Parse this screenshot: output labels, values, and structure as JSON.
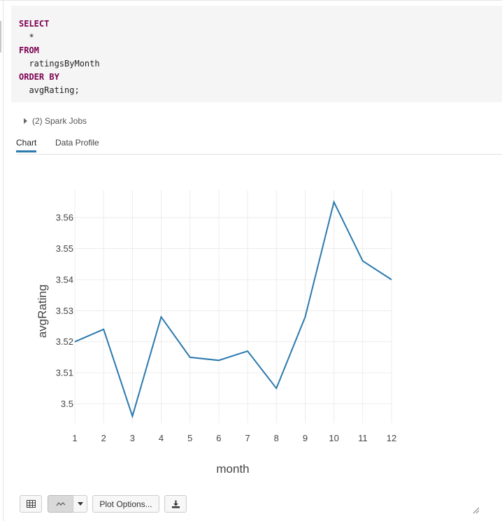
{
  "code": {
    "lines": [
      {
        "text": "SELECT",
        "keyword": true
      },
      {
        "text": "  *",
        "keyword": false
      },
      {
        "text": "FROM",
        "keyword": true
      },
      {
        "text": "  ratingsByMonth",
        "keyword": false
      },
      {
        "text": "ORDER BY",
        "keyword": true
      },
      {
        "text": "  avgRating;",
        "keyword": false
      }
    ]
  },
  "spark_jobs": {
    "label": "(2) Spark Jobs"
  },
  "tabs": [
    {
      "label": "Chart",
      "active": true
    },
    {
      "label": "Data Profile",
      "active": false
    }
  ],
  "chart_data": {
    "type": "line",
    "xlabel": "month",
    "ylabel": "avgRating",
    "x": [
      1,
      2,
      3,
      4,
      5,
      6,
      7,
      8,
      9,
      10,
      11,
      12
    ],
    "series": [
      {
        "values": [
          3.52,
          3.524,
          3.496,
          3.528,
          3.515,
          3.514,
          3.517,
          3.505,
          3.528,
          3.565,
          3.546,
          3.54
        ]
      }
    ],
    "xticks": [
      "1",
      "2",
      "3",
      "4",
      "5",
      "6",
      "7",
      "8",
      "9",
      "10",
      "11",
      "12"
    ],
    "yticks": [
      3.5,
      3.51,
      3.52,
      3.53,
      3.54,
      3.55,
      3.56
    ],
    "ytick_labels": [
      "3.5",
      "3.51",
      "3.52",
      "3.53",
      "3.54",
      "3.55",
      "3.56"
    ],
    "xlim": [
      1,
      12
    ],
    "ylim": [
      3.4938,
      3.5688
    ],
    "grid": true,
    "line_color": "#2b79ae"
  },
  "toolbar": {
    "table_icon": "table-icon",
    "line_chart_icon": "line-chart-icon",
    "dropdown_icon": "chevron-down-icon",
    "plot_options_label": "Plot Options...",
    "download_icon": "download-icon"
  }
}
